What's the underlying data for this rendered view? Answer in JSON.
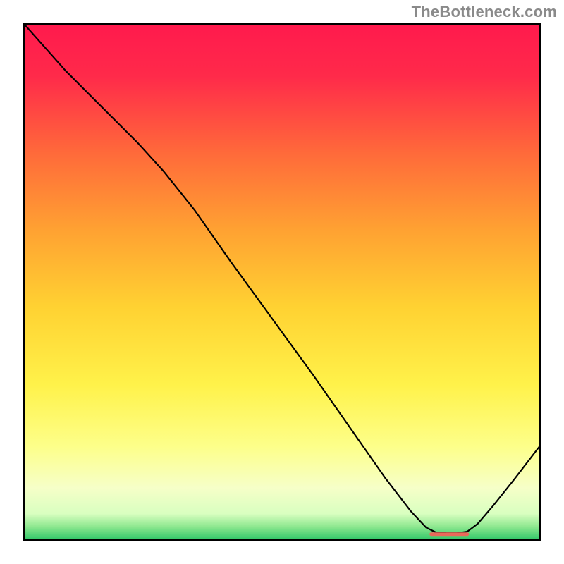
{
  "watermark": "TheBottleneck.com",
  "chart_data": {
    "type": "line",
    "title": "",
    "xlabel": "",
    "ylabel": "",
    "xlim": [
      0,
      100
    ],
    "ylim": [
      0,
      100
    ],
    "grid": false,
    "gradient_stops": [
      {
        "offset": 0,
        "color": "#ff1a4d"
      },
      {
        "offset": 0.1,
        "color": "#ff2a4a"
      },
      {
        "offset": 0.25,
        "color": "#ff6a3a"
      },
      {
        "offset": 0.4,
        "color": "#ffa232"
      },
      {
        "offset": 0.55,
        "color": "#ffd232"
      },
      {
        "offset": 0.7,
        "color": "#fff24a"
      },
      {
        "offset": 0.82,
        "color": "#fdff8a"
      },
      {
        "offset": 0.9,
        "color": "#f6ffc8"
      },
      {
        "offset": 0.95,
        "color": "#d9ffc0"
      },
      {
        "offset": 0.975,
        "color": "#8fe890"
      },
      {
        "offset": 1.0,
        "color": "#33c86a"
      }
    ],
    "curve": {
      "name": "bottleneck-curve",
      "color": "#000000",
      "width": 2.2,
      "points_xy": [
        [
          0,
          100
        ],
        [
          8,
          91
        ],
        [
          15,
          84
        ],
        [
          22,
          77
        ],
        [
          27,
          71.5
        ],
        [
          33,
          64
        ],
        [
          40,
          54
        ],
        [
          48,
          43
        ],
        [
          56,
          32
        ],
        [
          63,
          22
        ],
        [
          70,
          12
        ],
        [
          75,
          5.5
        ],
        [
          78,
          2.3
        ],
        [
          80,
          1.3
        ],
        [
          82,
          1.2
        ],
        [
          84,
          1.2
        ],
        [
          86,
          1.5
        ],
        [
          88,
          3
        ],
        [
          91,
          6.5
        ],
        [
          95,
          11.5
        ],
        [
          100,
          18
        ]
      ]
    },
    "flat_marker": {
      "name": "optimal-band-marker",
      "color": "#e86a5a",
      "x_start": 79,
      "x_end": 86,
      "y": 1.0,
      "thickness": 5
    }
  }
}
